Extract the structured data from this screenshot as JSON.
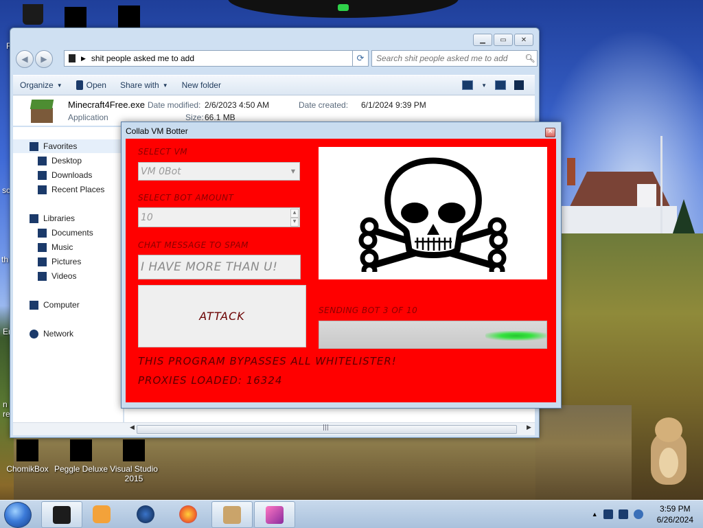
{
  "desktop": {
    "edge_labels": [
      "F",
      "sc",
      "th",
      "Er",
      "n re"
    ],
    "icons": [
      {
        "label": "ChomikBox"
      },
      {
        "label": "Peggle Deluxe"
      },
      {
        "label": "Visual Studio 2015"
      }
    ]
  },
  "explorer": {
    "address_path": "shit people asked me to add",
    "search_placeholder": "Search shit people asked me to add",
    "toolbar": {
      "organize": "Organize",
      "open": "Open",
      "share_with": "Share with",
      "new_folder": "New folder"
    },
    "details": {
      "file_name": "Minecraft4Free.exe",
      "file_type": "Application",
      "date_modified_label": "Date modified:",
      "date_modified": "2/6/2023 4:50 AM",
      "date_created_label": "Date created:",
      "date_created": "6/1/2024 9:39 PM",
      "size_label": "Size:",
      "size": "66.1 MB"
    },
    "nav": {
      "favorites": "Favorites",
      "desktop": "Desktop",
      "downloads": "Downloads",
      "recent": "Recent Places",
      "libraries": "Libraries",
      "documents": "Documents",
      "music": "Music",
      "pictures": "Pictures",
      "videos": "Videos",
      "computer": "Computer",
      "network": "Network"
    }
  },
  "botter": {
    "title": "Collab VM Botter",
    "select_vm_label": "SELECT VM",
    "vm_value": "VM 0Bot",
    "bot_amount_label": "SELECT BOT AMOUNT",
    "bot_amount": "10",
    "chat_label": "CHAT MESSAGE TO SPAM",
    "chat_message": "I HAVE MORE THAN U!",
    "attack_label": "ATTACK",
    "progress_label": "SENDING BOT 3 OF 10",
    "progress_fraction": 0.3,
    "bypass_text": "THIS PROGRAM BYPASSES ALL WHITELISTER!",
    "proxies_text": "PROXIES LOADED: 16324"
  },
  "taskbar": {
    "time": "3:59 PM",
    "date": "6/26/2024"
  },
  "colors": {
    "botter_red": "#ff0000",
    "progress_green": "#27c431"
  }
}
